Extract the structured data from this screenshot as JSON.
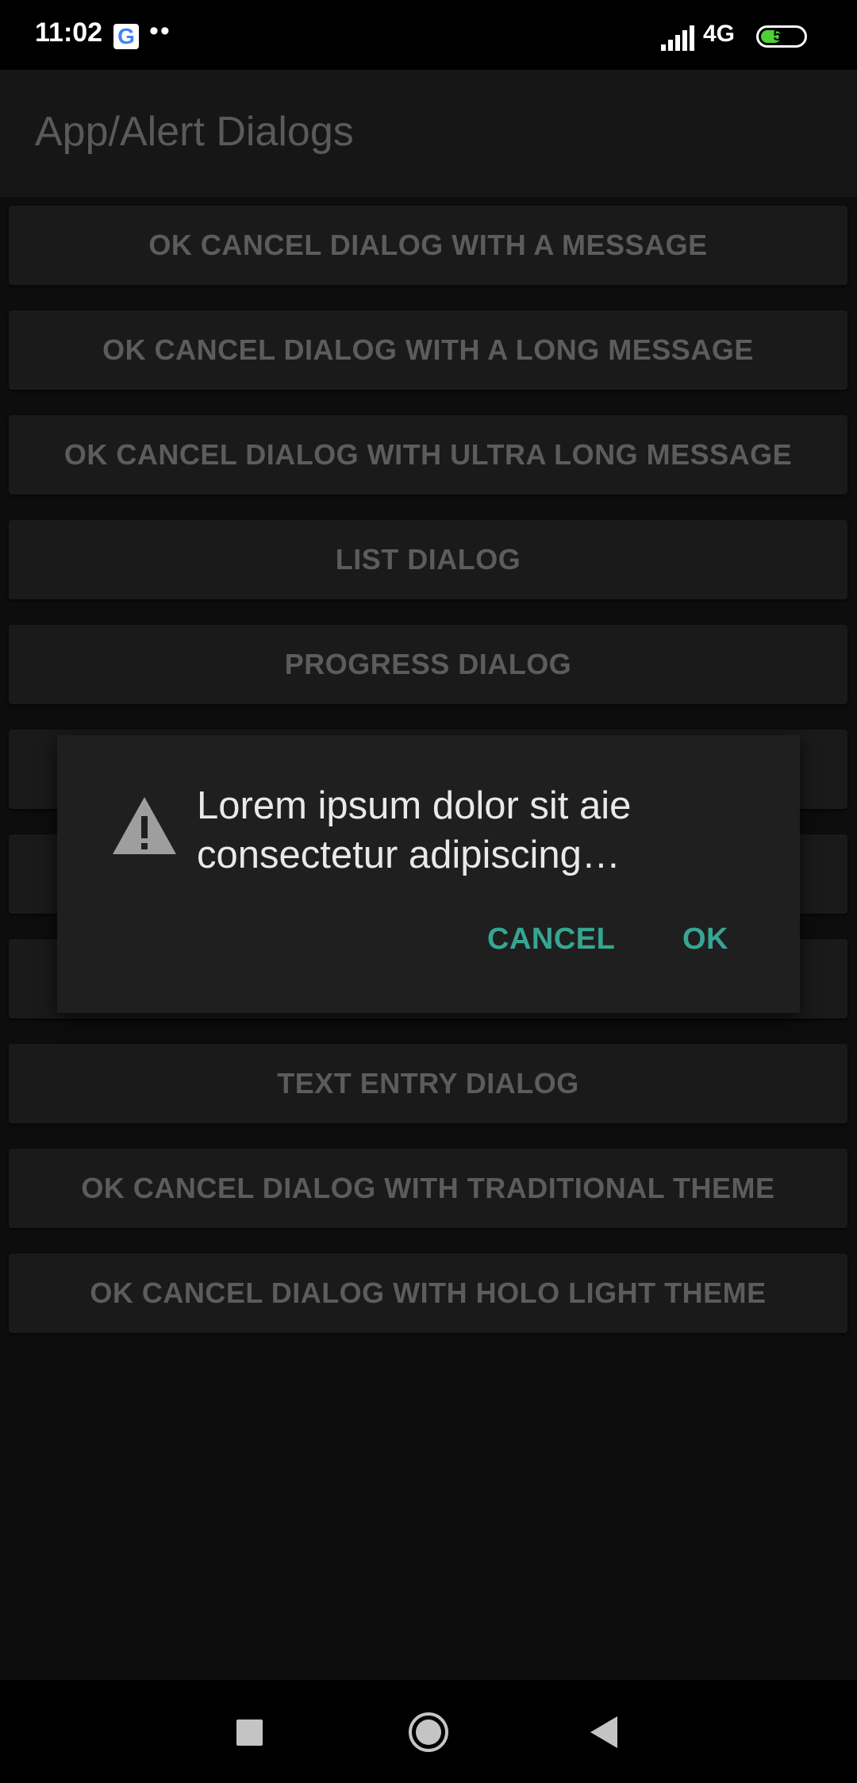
{
  "status_bar": {
    "time": "11:02",
    "app_icon": "google-icon",
    "app_icon_letter": "G",
    "notification_dots": "••",
    "network": "4G",
    "battery_level": "53",
    "battery_color": "#4cd137"
  },
  "app_bar": {
    "title": "App/Alert Dialogs"
  },
  "buttons": [
    {
      "label": "OK CANCEL DIALOG WITH A MESSAGE"
    },
    {
      "label": "OK CANCEL DIALOG WITH A LONG MESSAGE"
    },
    {
      "label": "OK CANCEL DIALOG WITH ULTRA LONG MESSAGE"
    },
    {
      "label": "LIST DIALOG"
    },
    {
      "label": "PROGRESS DIALOG"
    },
    {
      "label": ""
    },
    {
      "label": ""
    },
    {
      "label": ""
    },
    {
      "label": "TEXT ENTRY DIALOG"
    },
    {
      "label": "OK CANCEL DIALOG WITH TRADITIONAL THEME"
    },
    {
      "label": "OK CANCEL DIALOG WITH HOLO LIGHT THEME"
    }
  ],
  "dialog": {
    "icon": "warning-icon",
    "message": "Lorem ipsum dolor sit aie consectetur adipiscing…",
    "cancel_label": "CANCEL",
    "ok_label": "OK",
    "accent_color": "#36a693"
  },
  "nav_bar": {
    "recents_icon": "square-icon",
    "home_icon": "circle-icon",
    "back_icon": "triangle-back-icon"
  }
}
